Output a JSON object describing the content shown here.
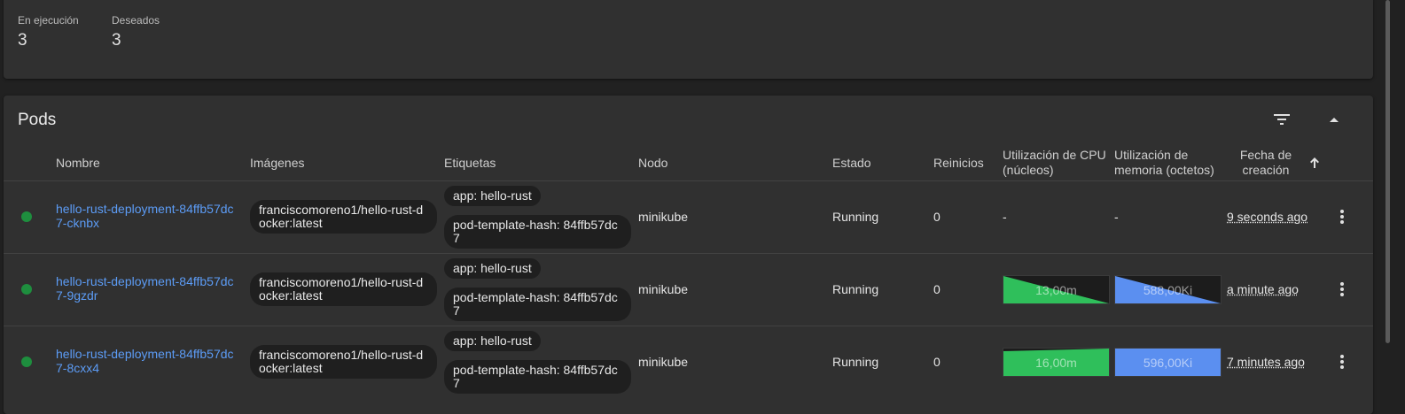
{
  "summary": {
    "running_label": "En ejecución",
    "running_value": "3",
    "desired_label": "Deseados",
    "desired_value": "3"
  },
  "pods_card": {
    "title": "Pods",
    "filter_icon": "filter-icon",
    "collapse_icon": "chevron-up-icon",
    "columns": {
      "name": "Nombre",
      "images": "Imágenes",
      "labels": "Etiquetas",
      "node": "Nodo",
      "status": "Estado",
      "restarts": "Reinicios",
      "cpu": "Utilización de CPU (núcleos)",
      "memory": "Utilización de memoria (octetos)",
      "created": "Fecha de creación"
    },
    "sort_icon": "arrow-up-icon",
    "rows": [
      {
        "name": "hello-rust-deployment-84ffb57dc7-cknbx",
        "image": "franciscomoreno1/hello-rust-docker:latest",
        "label_app": "app: hello-rust",
        "label_hash": "pod-template-hash: 84ffb57dc7",
        "node": "minikube",
        "status": "Running",
        "restarts": "0",
        "cpu": "-",
        "memory": "-",
        "age": "9 seconds ago"
      },
      {
        "name": "hello-rust-deployment-84ffb57dc7-9gzdr",
        "image": "franciscomoreno1/hello-rust-docker:latest",
        "label_app": "app: hello-rust",
        "label_hash": "pod-template-hash: 84ffb57dc7",
        "node": "minikube",
        "status": "Running",
        "restarts": "0",
        "cpu": "13,00m",
        "memory": "588,00Ki",
        "age": "a minute ago"
      },
      {
        "name": "hello-rust-deployment-84ffb57dc7-8cxx4",
        "image": "franciscomoreno1/hello-rust-docker:latest",
        "label_app": "app: hello-rust",
        "label_hash": "pod-template-hash: 84ffb57dc7",
        "node": "minikube",
        "status": "Running",
        "restarts": "0",
        "cpu": "16,00m",
        "memory": "596,00Ki",
        "age": "7 minutes ago"
      }
    ]
  },
  "colors": {
    "status_running": "#1e8e3e",
    "link": "#5c9cf6",
    "cpu_spark": "#2fbf5b",
    "memory_spark": "#5b8ff0"
  }
}
